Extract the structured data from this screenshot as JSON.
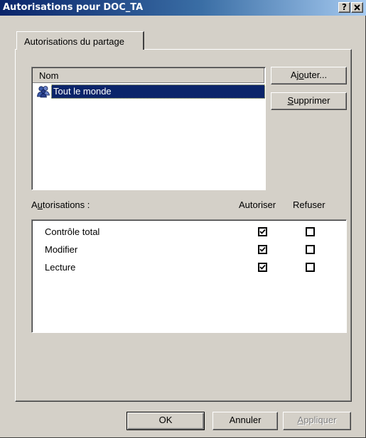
{
  "window": {
    "title": "Autorisations pour DOC_TA",
    "help_button": "?",
    "close_button": "✕"
  },
  "tab": {
    "label": "Autorisations du partage"
  },
  "users_list": {
    "column_header": "Nom",
    "items": [
      {
        "label": "Tout le monde",
        "selected": true,
        "icon": "users-group-icon"
      }
    ]
  },
  "buttons": {
    "add": {
      "pre": "Aj",
      "mn": "o",
      "post": "uter..."
    },
    "remove": {
      "pre": "",
      "mn": "S",
      "post": "upprimer"
    }
  },
  "permissions": {
    "label": {
      "pre": "A",
      "mn": "u",
      "post": "torisations :"
    },
    "allow_header": "Autoriser",
    "deny_header": "Refuser",
    "rows": [
      {
        "label": "Contrôle total",
        "allow": true,
        "deny": false
      },
      {
        "label": "Modifier",
        "allow": true,
        "deny": false
      },
      {
        "label": "Lecture",
        "allow": true,
        "deny": false
      }
    ]
  },
  "footer": {
    "ok": "OK",
    "cancel": "Annuler",
    "apply": {
      "pre": "",
      "mn": "A",
      "post": "ppliquer"
    }
  }
}
